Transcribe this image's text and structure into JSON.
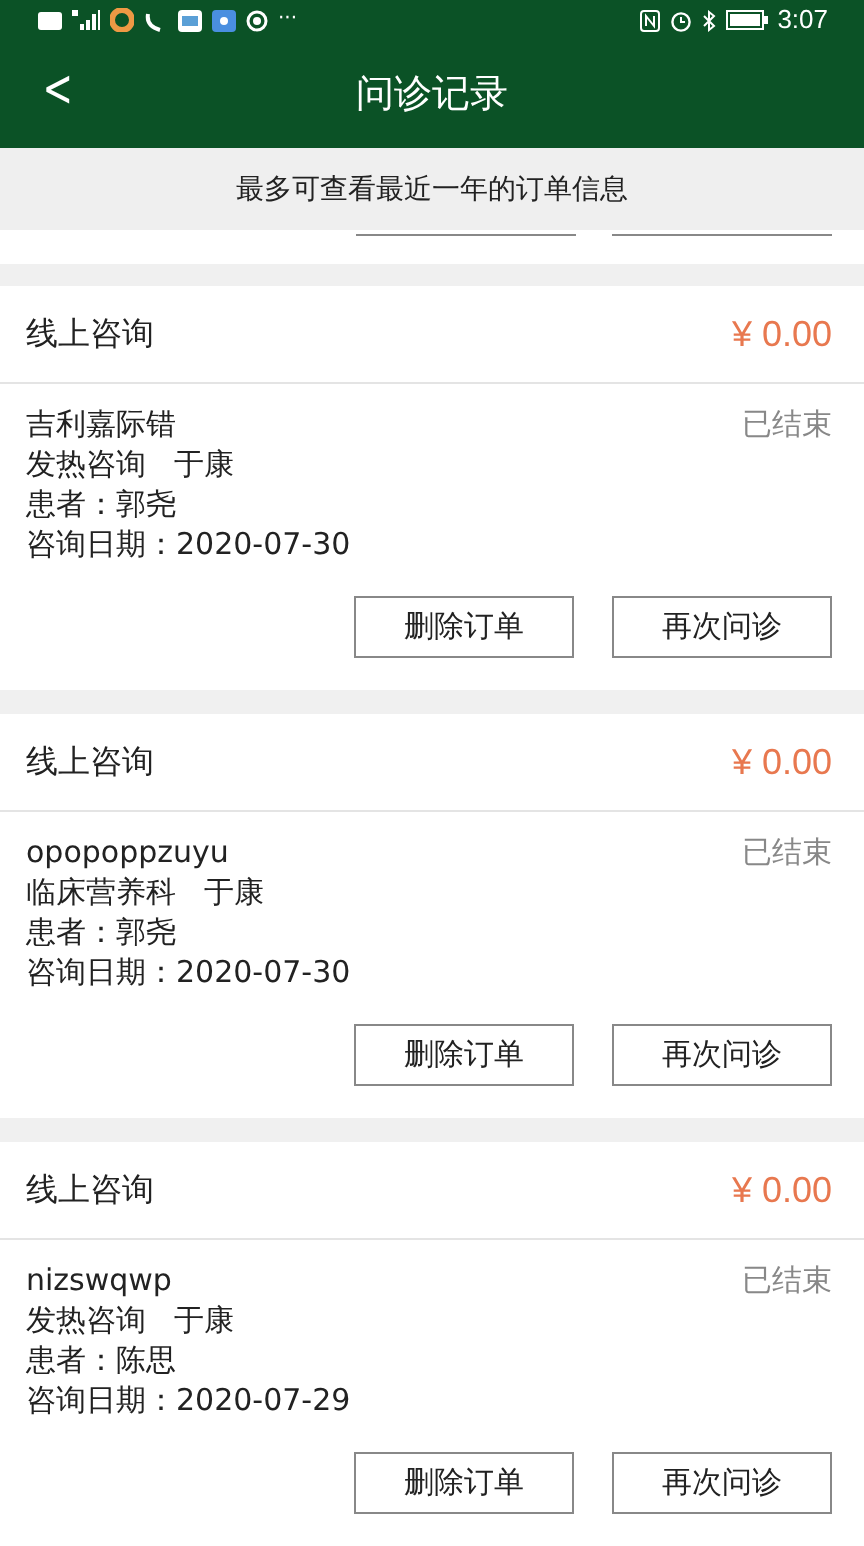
{
  "status_bar": {
    "more": "···",
    "time": "3:07"
  },
  "header": {
    "back": "<",
    "title": "问诊记录"
  },
  "notice": "最多可查看最近一年的订单信息",
  "orders": [
    {
      "type": "线上咨询",
      "price": "¥ 0.00",
      "name": "吉利嘉际错",
      "status": "已结束",
      "department": "发热咨询",
      "doctor": "于康",
      "patient": "患者：郭尧",
      "date": "咨询日期：2020-07-30",
      "buttons": [
        "删除订单",
        "再次问诊"
      ]
    },
    {
      "type": "线上咨询",
      "price": "¥ 0.00",
      "name": "opopoppzuyu",
      "status": "已结束",
      "department": "临床营养科",
      "doctor": "于康",
      "patient": "患者：郭尧",
      "date": "咨询日期：2020-07-30",
      "buttons": [
        "删除订单",
        "再次问诊"
      ]
    },
    {
      "type": "线上咨询",
      "price": "¥ 0.00",
      "name": "nizswqwp",
      "status": "已结束",
      "department": "发热咨询",
      "doctor": "于康",
      "patient": "患者：陈思",
      "date": "咨询日期：2020-07-29",
      "buttons": [
        "删除订单",
        "再次问诊"
      ]
    }
  ]
}
